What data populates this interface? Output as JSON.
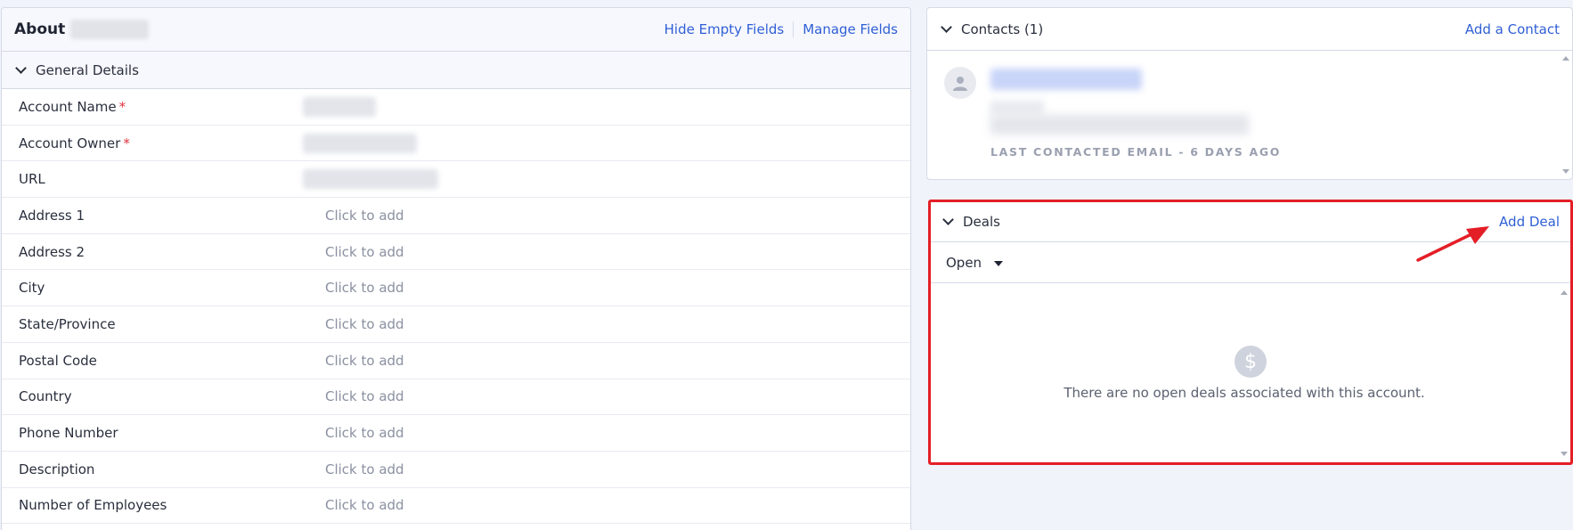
{
  "about": {
    "title": "About",
    "hide_empty_fields": "Hide Empty Fields",
    "manage_fields": "Manage Fields",
    "section_title": "General Details",
    "fields": [
      {
        "label": "Account Name",
        "required": "*",
        "value": ""
      },
      {
        "label": "Account Owner",
        "required": "*",
        "value": ""
      },
      {
        "label": "URL",
        "required": "",
        "value": ""
      },
      {
        "label": "Address 1",
        "required": "",
        "value": "Click to add"
      },
      {
        "label": "Address 2",
        "required": "",
        "value": "Click to add"
      },
      {
        "label": "City",
        "required": "",
        "value": "Click to add"
      },
      {
        "label": "State/Province",
        "required": "",
        "value": "Click to add"
      },
      {
        "label": "Postal Code",
        "required": "",
        "value": "Click to add"
      },
      {
        "label": "Country",
        "required": "",
        "value": "Click to add"
      },
      {
        "label": "Phone Number",
        "required": "",
        "value": "Click to add"
      },
      {
        "label": "Description",
        "required": "",
        "value": "Click to add"
      },
      {
        "label": "Number of Employees",
        "required": "",
        "value": "Click to add"
      }
    ]
  },
  "contacts": {
    "title": "Contacts (1)",
    "add_link": "Add a Contact",
    "last_contacted": "LAST CONTACTED EMAIL - 6 DAYS AGO"
  },
  "deals": {
    "title": "Deals",
    "add_link": "Add Deal",
    "filter_value": "Open",
    "empty_icon": "$",
    "empty_message": "There are no open deals associated with this account."
  },
  "colors": {
    "link": "#2f5fd6",
    "highlight_border": "#e41e26",
    "required": "#e0323c"
  },
  "icons": [
    "chevron-down-icon",
    "person-icon",
    "dollar-icon",
    "caret-down-icon",
    "red-arrow-annotation"
  ]
}
